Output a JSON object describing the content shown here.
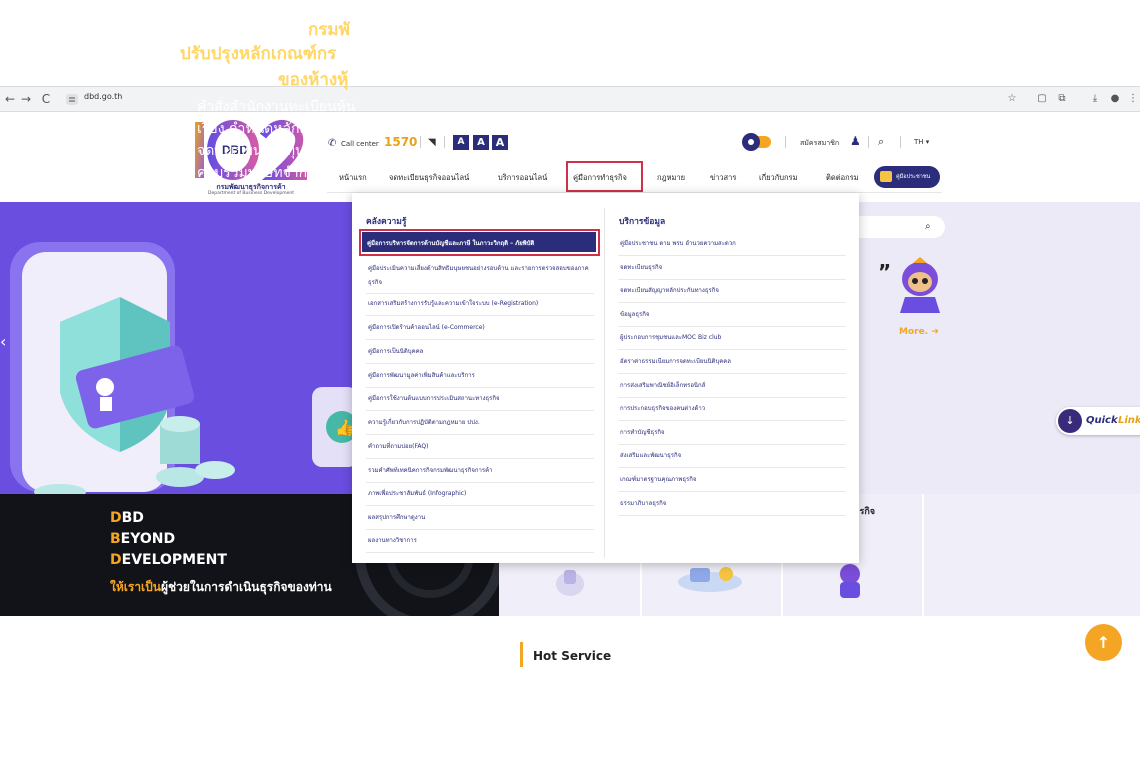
{
  "browser": {
    "url": "dbd.go.th",
    "back_icon": "←",
    "forward_icon": "→",
    "reload_icon": "C"
  },
  "header": {
    "logo_text": "102",
    "logo_sub_th": "กรมพัฒนาธุรกิจการค้า",
    "logo_sub_en": "Department of Business Development",
    "call_center_label": "Call center",
    "call_center_number": "1570",
    "font_sizes": [
      "A",
      "A",
      "A"
    ],
    "register_label": "สมัครสมาชิก",
    "language": "TH"
  },
  "menu": {
    "items": [
      "หน้าแรก",
      "จดทะเบียนธุรกิจออนไลน์",
      "บริการออนไลน์",
      "คู่มือการทำธุรกิจ",
      "กฎหมาย",
      "ข่าวสาร",
      "เกี่ยวกับกรม",
      "ติดต่อกรม"
    ],
    "manual_button": "คู่มือประชาชน"
  },
  "hero": {
    "title_line1": "กรมพั",
    "title_line2": "ปรับปรุงหลักเกณฑ์กร",
    "title_line3": "ของห้างหุ้",
    "body_lines": [
      "คำสั่งสำนักงานทะเบียนหุ้น",
      "เรื่อง กำหนดหลักเกณฑ์แล",
      "จดทะเบียนเพิ่มทุนของห้าง",
      "ควบรวมบริษัทจำกัดที่มีกา"
    ],
    "more_label": "More.",
    "quote_glyph": "”",
    "quicklink_label": "Quick",
    "quicklink_label2": "Link"
  },
  "banner": {
    "line1_cap": "D",
    "line1_rest": "BD",
    "line2_cap": "B",
    "line2_rest": "EYOND",
    "line3_cap": "D",
    "line3_rest": "EVELOPMENT",
    "tagline_accent": "ให้เราเป็น",
    "tagline_rest": "ผู้ช่วยในการดำเนินธุรกิจของท่าน",
    "card_business_label": "ธุรกิจ"
  },
  "dropdown": {
    "left_heading": "คลังความรู้",
    "right_heading": "บริการข้อมูล",
    "left_items": [
      "คู่มือการบริหารจัดการด้านบัญชีและภาษี ในภาวะวิกฤติ – ภัยพิบัติ",
      "คู่มือประเมินความเสี่ยงด้านสิทธิมนุษยชนอย่างรอบด้าน และรายการตรวจสอบของภาคธุรกิจ",
      "เอกสารเสริมสร้างการรับรู้และความเข้าใจระบบ (e-Registration)",
      "คู่มือการเปิดร้านค้าออนไลน์ (e-Commerce)",
      "คู่มือการเป็นนิติบุคคล",
      "คู่มือการพัฒนามูลค่าเพิ่มสินค้าและบริการ",
      "คู่มือการใช้งานต้นแบบการประเมินสถานะทางธุรกิจ",
      "ความรู้เกี่ยวกับการปฏิบัติตามกฎหมาย ปปง.",
      "คำถามที่ถามบ่อย(FAQ)",
      "รวมคำศัพท์เทคนิคการกิจกรมพัฒนาธุรกิจการค้า",
      "ภาพเพื่อประชาสัมพันธ์ (Infographic)",
      "ผลสรุปการศึกษาดูงาน",
      "ผลงานทางวิชาการ"
    ],
    "right_items": [
      "คู่มือประชาชน ตาม พรบ อำนวยความสะดวก",
      "จดทะเบียนธุรกิจ",
      "จดทะเบียนสัญญาหลักประกันทางธุรกิจ",
      "ข้อมูลธุรกิจ",
      "ผู้ประกอบการชุมชนและMOC Biz club",
      "อัตราค่าธรรมเนียมการจดทะเบียนนิติบุคคล",
      "การส่งเสริมพาณิชย์อิเล็กทรอนิกส์",
      "การประกอบธุรกิจของคนต่างด้าว",
      "การทำบัญชีธุรกิจ",
      "ส่งเสริมและพัฒนาธุรกิจ",
      "เกณฑ์มาตรฐานคุณภาพธุรกิจ",
      "ธรรมาภิบาลธุรกิจ"
    ]
  },
  "footer": {
    "hot_service": "Hot Service",
    "to_top_icon": "↑"
  },
  "colors": {
    "brand_navy": "#2b2d7a",
    "accent_orange": "#f5a524",
    "highlight_red": "#d0314a",
    "hero_purple": "#6a4ee0"
  }
}
